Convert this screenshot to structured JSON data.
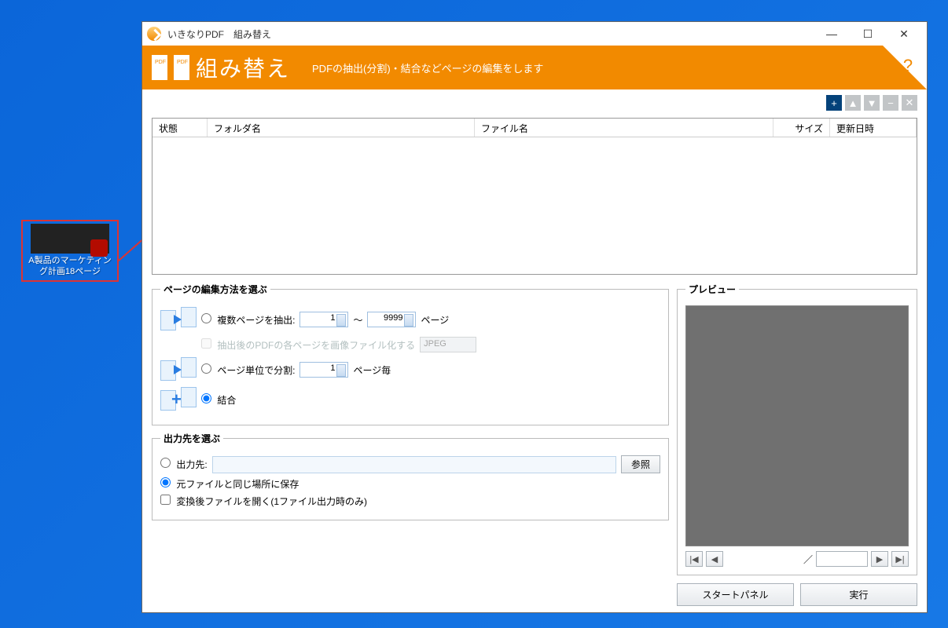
{
  "desktop": {
    "file_label": "A製品のマーケティング計画18ページ"
  },
  "window": {
    "title": "いきなりPDF　組み替え",
    "header_title": "組み替え",
    "header_sub": "PDFの抽出(分割)・結合などページの編集をします"
  },
  "toolbar": {
    "add": "+",
    "up": "▲",
    "down": "▼",
    "remove": "−",
    "clear": "✕"
  },
  "table": {
    "cols": {
      "state": "状態",
      "folder": "フォルダ名",
      "file": "ファイル名",
      "size": "サイズ",
      "date": "更新日時"
    }
  },
  "edit": {
    "legend": "ページの編集方法を選ぶ",
    "extract_label": "複数ページを抽出:",
    "extract_from": "1",
    "extract_sep": "～",
    "extract_to": "9999",
    "extract_unit": "ページ",
    "imagize_label": "抽出後のPDFの各ページを画像ファイル化する",
    "image_format": "JPEG",
    "split_label": "ページ単位で分割:",
    "split_value": "1",
    "split_unit": "ページ毎",
    "merge_label": "結合"
  },
  "output": {
    "legend": "出力先を選ぶ",
    "dest_label": "出力先:",
    "browse": "参照",
    "same_label": "元ファイルと同じ場所に保存",
    "open_label": "変換後ファイルを開く(1ファイル出力時のみ)"
  },
  "preview": {
    "legend": "プレビュー",
    "sep": "／",
    "first": "|◀",
    "prev": "◀",
    "next": "▶",
    "last": "▶|"
  },
  "actions": {
    "start": "スタートパネル",
    "run": "実行"
  },
  "help_icon": "?",
  "book_icon": "⎘"
}
